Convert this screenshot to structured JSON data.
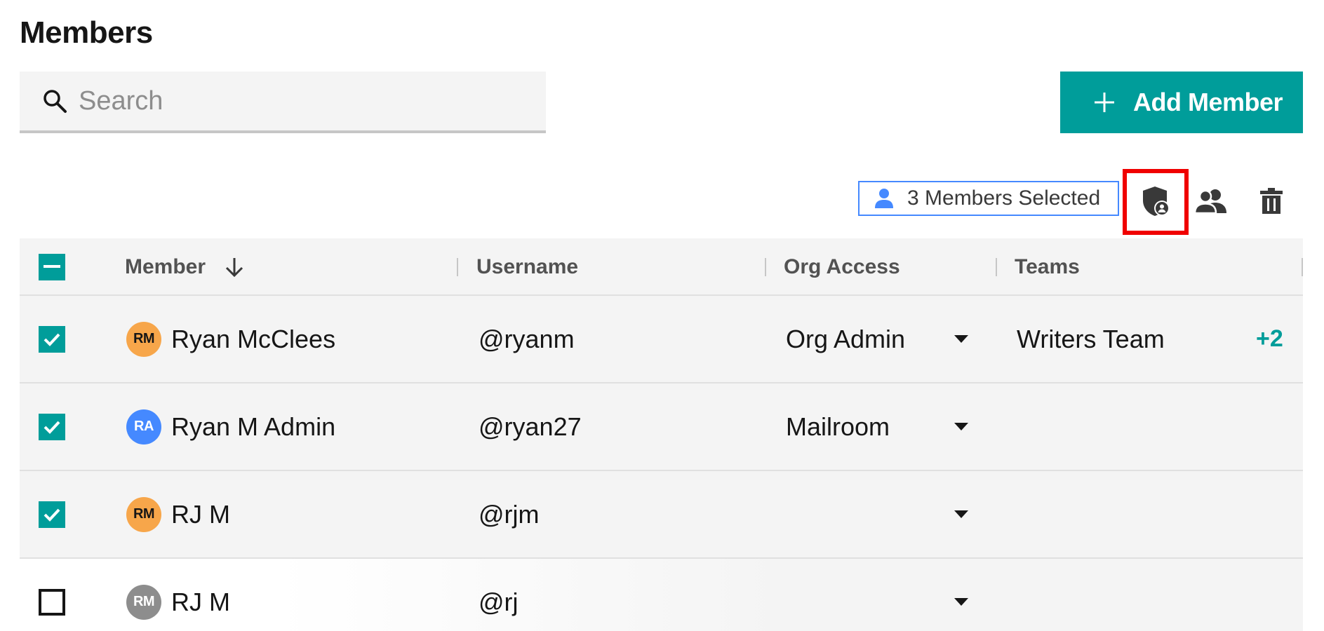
{
  "page": {
    "title": "Members"
  },
  "search": {
    "placeholder": "Search",
    "value": ""
  },
  "actions": {
    "add_member_label": "Add Member"
  },
  "selection": {
    "label": "3 Members Selected"
  },
  "toolbar": {
    "assign_role_icon": "shield-user-icon",
    "assign_team_icon": "group-icon",
    "delete_icon": "trash-icon"
  },
  "table": {
    "columns": {
      "member": "Member",
      "username": "Username",
      "org_access": "Org Access",
      "teams": "Teams"
    },
    "sort": {
      "column": "member",
      "direction": "descending-arrow"
    },
    "header_checkbox": "indeterminate",
    "rows": [
      {
        "checked": true,
        "initials": "RM",
        "avatar_color": "#f7a64a",
        "avatar_text_color": "#161616",
        "name": "Ryan McClees",
        "username": "@ryanm",
        "org_access": "Org Admin",
        "teams": "Writers Team",
        "more_teams": "+2"
      },
      {
        "checked": true,
        "initials": "RA",
        "avatar_color": "#4589ff",
        "avatar_text_color": "#ffffff",
        "name": "Ryan M Admin",
        "username": "@ryan27",
        "org_access": "Mailroom",
        "teams": "",
        "more_teams": ""
      },
      {
        "checked": true,
        "initials": "RM",
        "avatar_color": "#f7a64a",
        "avatar_text_color": "#161616",
        "name": "RJ M",
        "username": "@rjm",
        "org_access": "",
        "teams": "",
        "more_teams": ""
      },
      {
        "checked": false,
        "initials": "RM",
        "avatar_color": "#8d8d8d",
        "avatar_text_color": "#ffffff",
        "name": "RJ M",
        "username": "@rj",
        "org_access": "",
        "teams": "",
        "more_teams": ""
      }
    ]
  },
  "colors": {
    "accent": "#009d9a",
    "selection_border": "#4589ff",
    "highlight": "#f00000"
  }
}
